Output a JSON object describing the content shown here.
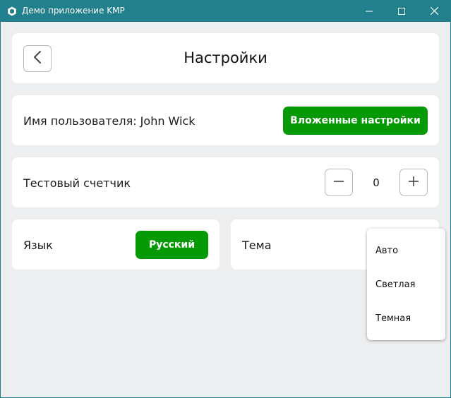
{
  "window": {
    "title": "Демо приложение KMP",
    "controls": {
      "minimize_icon": "minimize-icon",
      "maximize_icon": "maximize-icon",
      "close_icon": "close-icon"
    }
  },
  "header": {
    "back_icon": "chevron-left-icon",
    "title": "Настройки"
  },
  "user": {
    "label": "Имя пользователя: John Wick",
    "nested_button": "Вложенные настройки"
  },
  "counter": {
    "label": "Тестовый счетчик",
    "value": "0",
    "minus_icon": "minus-icon",
    "plus_icon": "plus-icon"
  },
  "language": {
    "label": "Язык",
    "button": "Русский"
  },
  "theme": {
    "label": "Тема",
    "options": [
      "Авто",
      "Светлая",
      "Темная"
    ]
  },
  "colors": {
    "titlebar": "#21808c",
    "accent_green": "#069b06",
    "background": "#edeef0",
    "card": "#ffffff"
  }
}
